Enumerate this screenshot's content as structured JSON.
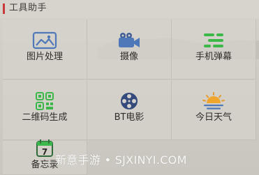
{
  "header": {
    "title": "工具助手"
  },
  "tools": [
    {
      "label": "图片处理",
      "icon": "image-icon"
    },
    {
      "label": "摄像",
      "icon": "camera-icon"
    },
    {
      "label": "手机弹幕",
      "icon": "danmaku-icon"
    },
    {
      "label": "二维码生成",
      "icon": "qr-code-icon"
    },
    {
      "label": "BT电影",
      "icon": "film-reel-icon"
    },
    {
      "label": "今日天气",
      "icon": "weather-icon"
    },
    {
      "label": "备忘录",
      "icon": "calendar-icon",
      "badge": "7"
    }
  ],
  "watermark": {
    "text": "新意手游 • SJXINYI.COM"
  },
  "colors": {
    "accent_red": "#c8393d",
    "blue": "#4f78b8",
    "green": "#3cb84a",
    "dark_blue": "#344a7d",
    "orange": "#e69a2e"
  }
}
